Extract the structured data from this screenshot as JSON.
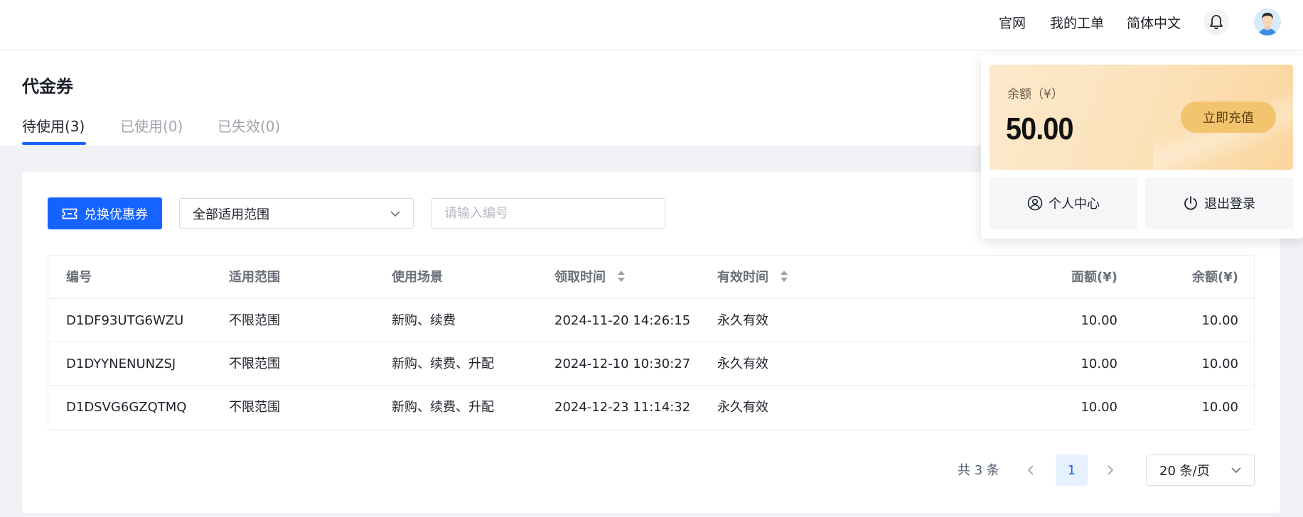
{
  "topbar": {
    "links": [
      "官网",
      "我的工单",
      "简体中文"
    ],
    "bell_icon": "bell-icon",
    "avatar_icon": "user-avatar"
  },
  "page": {
    "title": "代金券",
    "tabs": [
      {
        "label": "待使用(3)",
        "active": true
      },
      {
        "label": "已使用(0)",
        "active": false
      },
      {
        "label": "已失效(0)",
        "active": false
      }
    ]
  },
  "toolbar": {
    "redeem_label": "兑换优惠券",
    "scope_select_value": "全部适用范围",
    "search_placeholder": "请输入编号"
  },
  "table": {
    "headers": [
      "编号",
      "适用范围",
      "使用场景",
      "领取时间",
      "有效时间",
      "面额(¥)",
      "余额(¥)"
    ],
    "rows": [
      [
        "D1DF93UTG6WZU",
        "不限范围",
        "新购、续费",
        "2024-11-20 14:26:15",
        "永久有效",
        "10.00",
        "10.00"
      ],
      [
        "D1DYYNENUNZSJ",
        "不限范围",
        "新购、续费、升配",
        "2024-12-10 10:30:27",
        "永久有效",
        "10.00",
        "10.00"
      ],
      [
        "D1DSVG6GZQTMQ",
        "不限范围",
        "新购、续费、升配",
        "2024-12-23 11:14:32",
        "永久有效",
        "10.00",
        "10.00"
      ]
    ]
  },
  "pagination": {
    "total_text": "共 3 条",
    "current_page": "1",
    "page_size": "20 条/页"
  },
  "popover": {
    "balance_label": "余额（¥）",
    "balance_amount": "50.00",
    "recharge_label": "立即充值",
    "profile_label": "个人中心",
    "logout_label": "退出登录"
  },
  "colors": {
    "primary": "#1664ff",
    "gold": "#f3c46e"
  }
}
